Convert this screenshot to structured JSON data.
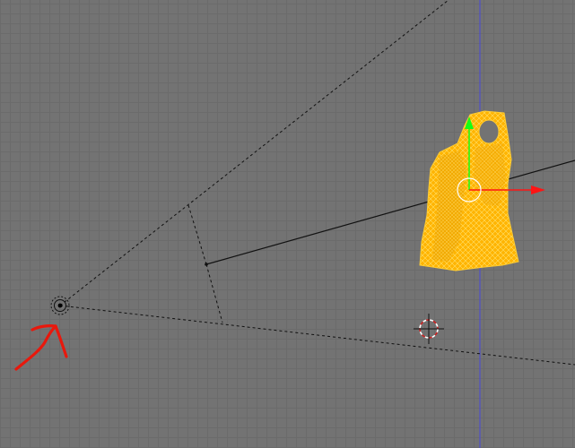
{
  "app": {
    "view": "3d-viewport"
  },
  "viewport": {
    "background_color": "#737373",
    "grid_color": "#6b6b6b",
    "axis_z_color": "#4a4ad8"
  },
  "scene": {
    "camera": {
      "icon": "camera-object-icon",
      "frustum_style": "dashed",
      "line_color": "#111111"
    },
    "mesh_object": {
      "icon": "mesh-wireframe-icon",
      "fill_color": "#ffb400",
      "wire_color": "#ffe06a",
      "selected": true
    },
    "transform_gizmo": {
      "icon": "move-gizmo-icon",
      "x_axis_color": "#ff1414",
      "y_axis_color": "#14ff14"
    },
    "cursor_3d": {
      "icon": "3d-cursor-icon",
      "ring_color": "#cc2222"
    },
    "annotation": {
      "icon": "red-arrow-annotation-icon",
      "color": "#e8180c"
    }
  }
}
